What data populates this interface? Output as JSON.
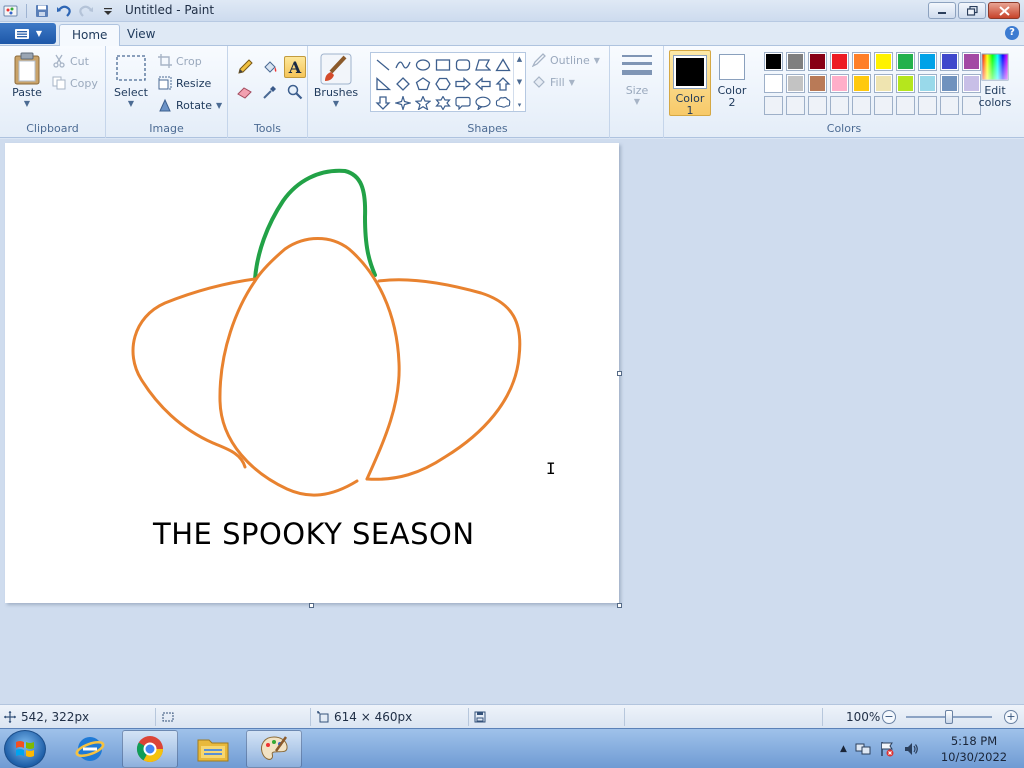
{
  "window": {
    "title": "Untitled - Paint"
  },
  "tabs": [
    {
      "label": "Home",
      "active": true
    },
    {
      "label": "View",
      "active": false
    }
  ],
  "clipboard": {
    "group_label": "Clipboard",
    "paste": "Paste",
    "cut": "Cut",
    "copy": "Copy"
  },
  "image": {
    "group_label": "Image",
    "select": "Select",
    "crop": "Crop",
    "resize": "Resize",
    "rotate": "Rotate"
  },
  "tools": {
    "group_label": "Tools",
    "items": [
      "pencil-icon",
      "fill-bucket-icon",
      "text-icon",
      "eraser-icon",
      "color-picker-icon",
      "magnifier-icon"
    ],
    "selected": "text-icon",
    "text_glyph": "A"
  },
  "brushes": {
    "label": "Brushes"
  },
  "shapes": {
    "group_label": "Shapes",
    "outline": "Outline",
    "fill": "Fill"
  },
  "size": {
    "label": "Size"
  },
  "colors": {
    "group_label": "Colors",
    "color1_label": "Color",
    "color1_num": "1",
    "color2_label": "Color",
    "color2_num": "2",
    "color1": "#000000",
    "color2": "#ffffff",
    "edit_label": "Edit",
    "edit_label2": "colors",
    "palette": [
      "#000000",
      "#7f7f7f",
      "#880015",
      "#ed1c24",
      "#ff7f27",
      "#fff200",
      "#22b14c",
      "#00a2e8",
      "#3f48cc",
      "#a349a4",
      "#ffffff",
      "#c3c3c3",
      "#b97a57",
      "#ffaec9",
      "#ffc90e",
      "#efe4b0",
      "#b5e61d",
      "#99d9ea",
      "#7092be",
      "#c8bfe7"
    ],
    "empty_slots": 10
  },
  "canvas": {
    "text": "THE SPOOKY SEASON",
    "stroke_colors": {
      "orange": "#e8822f",
      "green": "#22a247"
    }
  },
  "statusbar": {
    "cursor_pos": "542, 322px",
    "canvas_size": "614 × 460px",
    "zoom": "100%"
  },
  "taskbar": {
    "time": "5:18 PM",
    "date": "10/30/2022"
  }
}
